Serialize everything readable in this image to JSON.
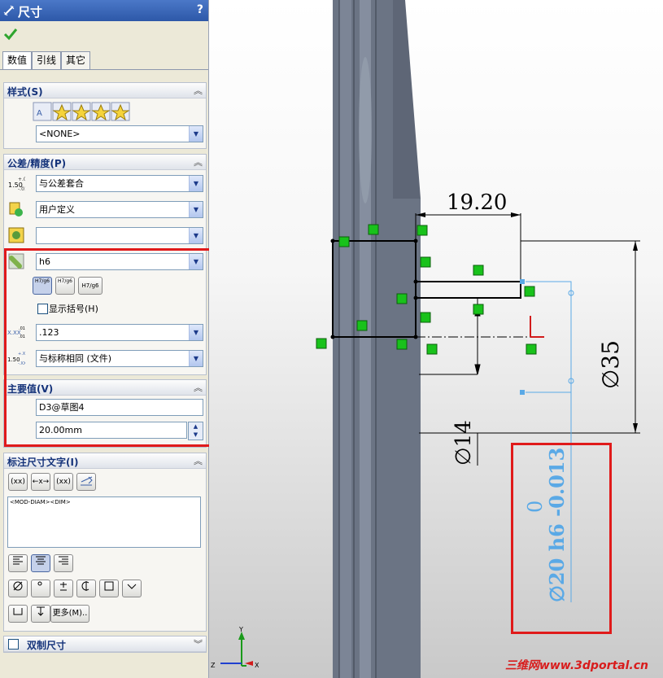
{
  "header": {
    "title": "尺寸",
    "help": "?"
  },
  "tabs": [
    {
      "label": "数值"
    },
    {
      "label": "引线"
    },
    {
      "label": "其它"
    }
  ],
  "style": {
    "title": "样式(S)",
    "selected": "<NONE>"
  },
  "tolerance": {
    "title": "公差/精度(P)",
    "type": "与公差套合",
    "classification": "用户定义",
    "hole_fit": "",
    "shaft_fit": "h6",
    "fit_buttons": [
      "H7/g6",
      "H7/g6",
      "H7/g6"
    ],
    "show_parentheses": "显示括号(H)",
    "primary_precision": ".123",
    "tolerance_precision": "与标称相同 (文件)"
  },
  "primary_value": {
    "title": "主要值(V)",
    "name": "D3@草图4",
    "value": "20.00mm"
  },
  "dimension_text": {
    "title": "标注尺寸文字(I)",
    "content": "<MOD-DIAM><DIM>",
    "more_button": "更多(M)..",
    "symbol_buttons": [
      "(xx)",
      "←x→",
      "(xx)"
    ]
  },
  "dual": {
    "title": "双制尺寸"
  },
  "drawing": {
    "dim_top": "19.20",
    "dim_right": "∅35",
    "dim_left": "∅14",
    "dim_tol_upper": "0",
    "dim_main": "∅20 h6 -0.013",
    "watermark": "三维网www.3dportal.cn"
  },
  "colors": {
    "accent": "#e01a1a",
    "sketch_green": "#19c21b",
    "dim_blue": "#5aa9e6"
  }
}
